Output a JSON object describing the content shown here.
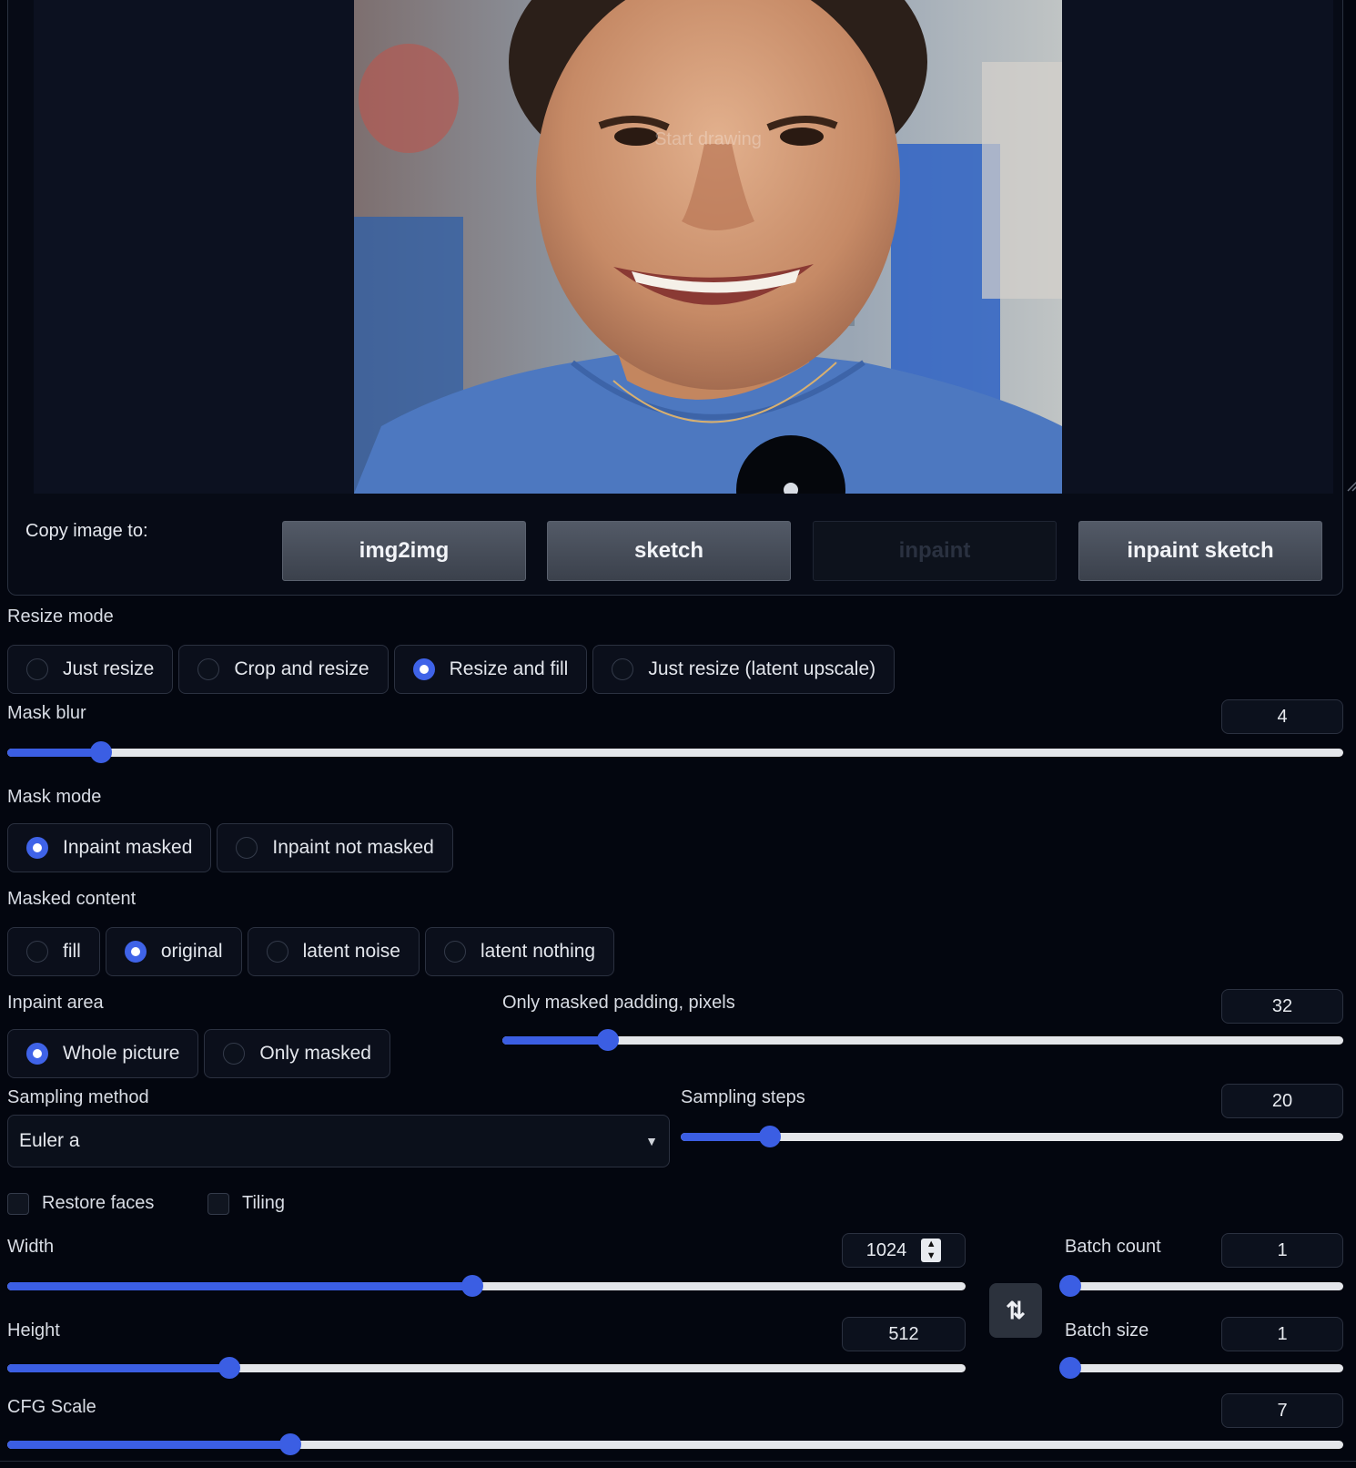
{
  "canvas": {
    "hint_text": "Start drawing"
  },
  "copy_image": {
    "label": "Copy image to:",
    "buttons": [
      "img2img",
      "sketch",
      "inpaint",
      "inpaint sketch"
    ]
  },
  "resize_mode": {
    "label": "Resize mode",
    "options": [
      "Just resize",
      "Crop and resize",
      "Resize and fill",
      "Just resize (latent upscale)"
    ],
    "selected": "Resize and fill"
  },
  "mask_blur": {
    "label": "Mask blur",
    "value": "4",
    "fraction": 0.07
  },
  "mask_mode": {
    "label": "Mask mode",
    "options": [
      "Inpaint masked",
      "Inpaint not masked"
    ],
    "selected": "Inpaint masked"
  },
  "masked_content": {
    "label": "Masked content",
    "options": [
      "fill",
      "original",
      "latent noise",
      "latent nothing"
    ],
    "selected": "original"
  },
  "inpaint_area": {
    "label": "Inpaint area",
    "options": [
      "Whole picture",
      "Only masked"
    ],
    "selected": "Whole picture"
  },
  "only_masked_padding": {
    "label": "Only masked padding, pixels",
    "value": "32",
    "fraction": 0.125
  },
  "sampling_method": {
    "label": "Sampling method",
    "value": "Euler a"
  },
  "sampling_steps": {
    "label": "Sampling steps",
    "value": "20",
    "fraction": 0.135
  },
  "restore_faces": {
    "label": "Restore faces",
    "checked": false
  },
  "tiling": {
    "label": "Tiling",
    "checked": false
  },
  "width": {
    "label": "Width",
    "value": "1024",
    "fraction": 0.485
  },
  "height": {
    "label": "Height",
    "value": "512",
    "fraction": 0.232
  },
  "batch_count": {
    "label": "Batch count",
    "value": "1",
    "fraction": 0.02
  },
  "batch_size": {
    "label": "Batch size",
    "value": "1",
    "fraction": 0.02
  },
  "cfg_scale": {
    "label": "CFG Scale",
    "value": "7",
    "fraction": 0.212
  },
  "swap_button": {
    "icon": "swap-vertical-icon",
    "glyph": "⇅"
  },
  "colors": {
    "accent": "#3b5ee3",
    "background": "#03060f"
  }
}
